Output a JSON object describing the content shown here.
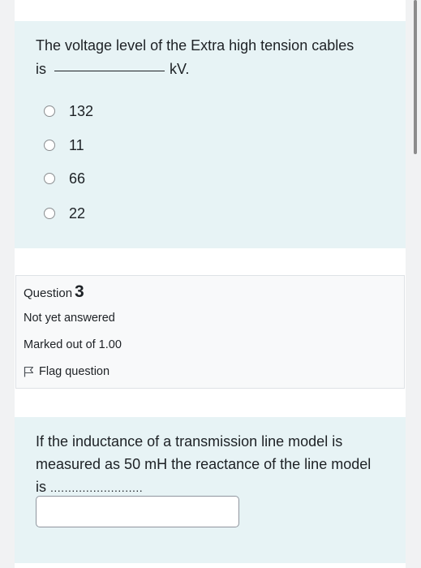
{
  "question2": {
    "text_part1": "The voltage level of the Extra high tension cables",
    "text_is": "is",
    "text_unit": "kV.",
    "options": [
      {
        "label": "132"
      },
      {
        "label": "11"
      },
      {
        "label": "66"
      },
      {
        "label": "22"
      }
    ]
  },
  "question3_info": {
    "prefix": "Question",
    "number": "3",
    "status": "Not yet answered",
    "marks": "Marked out of 1.00",
    "flag_label": "Flag question"
  },
  "question3": {
    "text": "If the inductance of a transmission line model is measured as 50 mH the reactance of the line model is",
    "dots": "..........................",
    "answer_value": ""
  },
  "colors": {
    "panel": "#e7f3f5",
    "info_box": "#f8f9fa",
    "text": "#1d2125"
  }
}
